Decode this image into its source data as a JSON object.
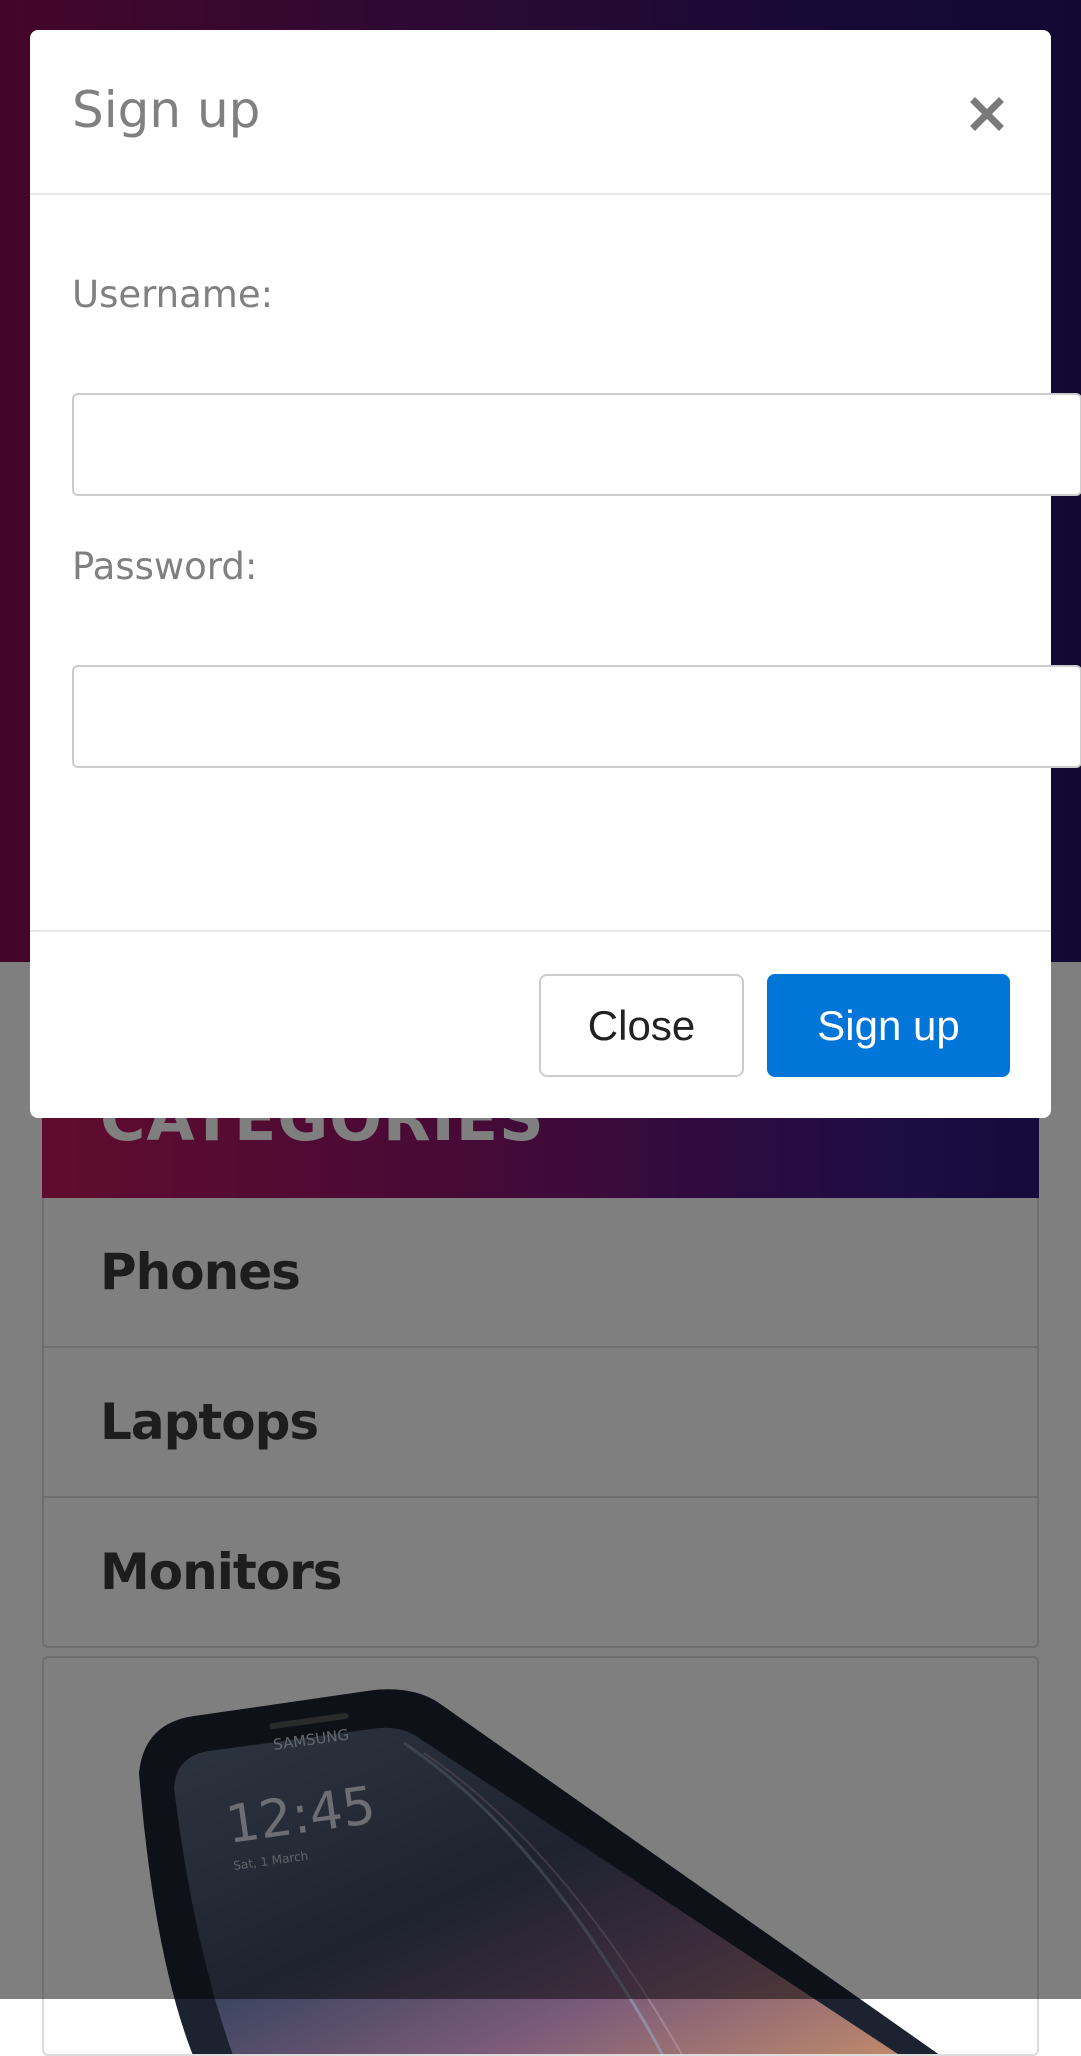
{
  "background": {
    "categories": {
      "header": "CATEGORIES",
      "items": [
        {
          "label": "Phones"
        },
        {
          "label": "Laptops"
        },
        {
          "label": "Monitors"
        }
      ]
    },
    "product": {
      "brand": "SAMSUNG",
      "time": "12:45",
      "date": "Sat, 1 March"
    }
  },
  "modal": {
    "title": "Sign up",
    "close_icon": "close-icon",
    "username_label": "Username:",
    "username_value": "",
    "password_label": "Password:",
    "password_value": "",
    "close_button": "Close",
    "signup_button": "Sign up"
  },
  "colors": {
    "primary": "#0275d8",
    "hero_gradient_start": "#8a0b54",
    "hero_gradient_end": "#241367",
    "label_gray": "#808080"
  }
}
